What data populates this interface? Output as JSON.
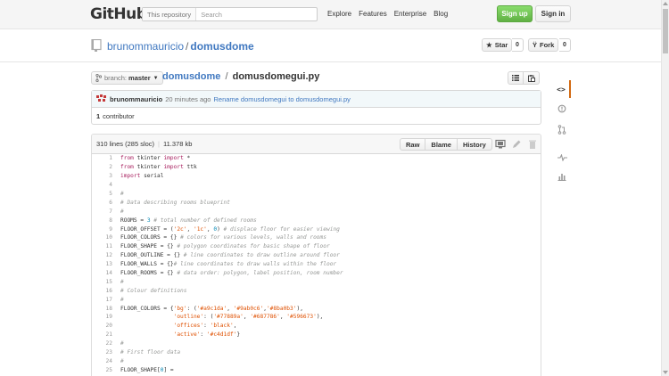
{
  "header": {
    "logo": "GitHub",
    "search_scope": "This repository",
    "search_placeholder": "Search",
    "nav": [
      "Explore",
      "Features",
      "Enterprise",
      "Blog"
    ],
    "signup": "Sign up",
    "signin": "Sign in"
  },
  "repo": {
    "owner": "brunommauricio",
    "separator": "/",
    "name": "domusdome",
    "star_label": "Star",
    "star_count": "0",
    "fork_label": "Fork",
    "fork_count": "0"
  },
  "filenav": {
    "branch_label": "branch:",
    "branch": "master",
    "crumb_root": "domusdome",
    "crumb_sep": "/",
    "crumb_file": "domusdomegui.py"
  },
  "commit": {
    "author": "brunommauricio",
    "time": "20 minutes ago",
    "message": "Rename domusdomegui to domusdomegui.py",
    "contributors_count": "1",
    "contributors_label": "contributor"
  },
  "file": {
    "lines_info": "310 lines (285 sloc)",
    "size": "11.378 kb",
    "buttons": [
      "Raw",
      "Blame",
      "History"
    ]
  },
  "code_lines": [
    "from tkinter import *",
    "from tkinter import ttk",
    "import serial",
    "",
    "#",
    "# Data describing rooms blueprint",
    "#",
    "ROOMS = 3 # total number of defined rooms",
    "FLOOR_OFFSET = ('2c', '1c', 0) # displace floor for easier viewing",
    "FLOOR_COLORS = {} # colors for various levels, walls and rooms",
    "FLOOR_SHAPE = {} # polygon coordinates for basic shape of floor",
    "FLOOR_OUTLINE = {} # line coordinates to draw outline around floor",
    "FLOOR_WALLS = {}# line coordinates to draw walls within the floor",
    "FLOOR_ROOMS = {} # data order: polygon, label position, room number",
    "#",
    "# Colour definitions",
    "#",
    "FLOOR_COLORS = {'bg': ('#a9c1da', '#9ab0c6','#8ba0b3'),",
    "\t\t\t\t'outline': ('#77889a', '#687786', '#596673'),",
    "\t\t\t\t'offices': 'black',",
    "\t\t\t\t'active': '#c4d1df'}",
    "#",
    "# First floor data",
    "#",
    "FLOOR_SHAPE[0] ="
  ],
  "sidebar_icons": [
    "code-icon",
    "issue-icon",
    "pull-request-icon",
    "pulse-icon",
    "graph-icon"
  ]
}
